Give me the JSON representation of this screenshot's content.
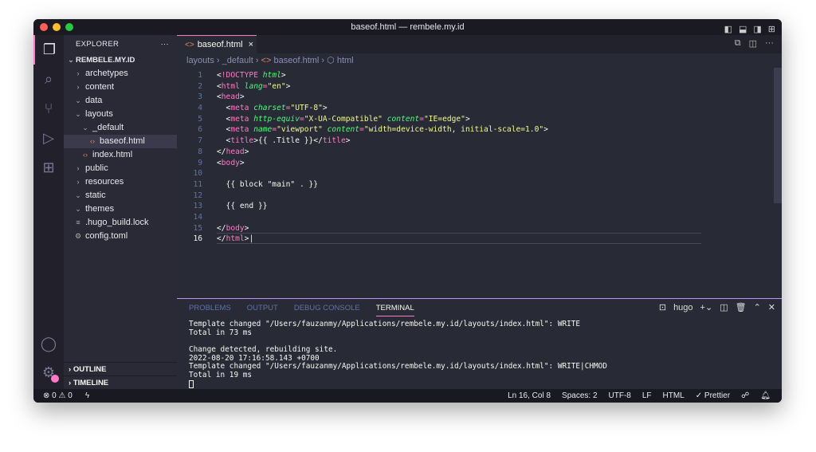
{
  "window": {
    "title": "baseof.html — rembele.my.id",
    "traffic": [
      "#ff5f57",
      "#febc2e",
      "#28c840"
    ]
  },
  "activity": [
    "files-icon",
    "search-icon",
    "source-control-icon",
    "run-debug-icon",
    "extensions-icon"
  ],
  "sidebar": {
    "title": "EXPLORER",
    "more": "···",
    "root": "REMBELE.MY.ID",
    "items": [
      {
        "label": "archetypes",
        "depth": 1,
        "type": "closed"
      },
      {
        "label": "content",
        "depth": 1,
        "type": "closed"
      },
      {
        "label": "data",
        "depth": 1,
        "type": "open"
      },
      {
        "label": "layouts",
        "depth": 1,
        "type": "open"
      },
      {
        "label": "_default",
        "depth": 2,
        "type": "open"
      },
      {
        "label": "baseof.html",
        "depth": 3,
        "type": "html",
        "selected": true
      },
      {
        "label": "index.html",
        "depth": 2,
        "type": "html"
      },
      {
        "label": "public",
        "depth": 1,
        "type": "closed"
      },
      {
        "label": "resources",
        "depth": 1,
        "type": "closed"
      },
      {
        "label": "static",
        "depth": 1,
        "type": "open"
      },
      {
        "label": "themes",
        "depth": 1,
        "type": "open"
      },
      {
        "label": ".hugo_build.lock",
        "depth": 1,
        "type": "file"
      },
      {
        "label": "config.toml",
        "depth": 1,
        "type": "gear"
      }
    ],
    "outline": "OUTLINE",
    "timeline": "TIMELINE"
  },
  "tab": {
    "label": "baseof.html",
    "close": "×"
  },
  "breadcrumbs": [
    "layouts",
    "_default",
    "baseof.html",
    "html"
  ],
  "code": [
    [
      [
        "<",
        "br"
      ],
      [
        "!DOCTYPE",
        "tag"
      ],
      [
        " html",
        "attr"
      ],
      [
        ">",
        "br"
      ]
    ],
    [
      [
        "<",
        "br"
      ],
      [
        "html",
        "tag"
      ],
      [
        " lang",
        "attr"
      ],
      [
        "=",
        "tag"
      ],
      [
        "\"en\"",
        "str"
      ],
      [
        ">",
        "br"
      ]
    ],
    [
      [
        "<",
        "br"
      ],
      [
        "head",
        "tag"
      ],
      [
        ">",
        "br"
      ]
    ],
    [
      [
        "  <",
        "br"
      ],
      [
        "meta",
        "tag"
      ],
      [
        " charset",
        "attr"
      ],
      [
        "=",
        "tag"
      ],
      [
        "\"UTF-8\"",
        "str"
      ],
      [
        ">",
        "br"
      ]
    ],
    [
      [
        "  <",
        "br"
      ],
      [
        "meta",
        "tag"
      ],
      [
        " http-equiv",
        "attr"
      ],
      [
        "=",
        "tag"
      ],
      [
        "\"X-UA-Compatible\"",
        "str"
      ],
      [
        " content",
        "attr"
      ],
      [
        "=",
        "tag"
      ],
      [
        "\"IE=edge\"",
        "str"
      ],
      [
        ">",
        "br"
      ]
    ],
    [
      [
        "  <",
        "br"
      ],
      [
        "meta",
        "tag"
      ],
      [
        " name",
        "attr"
      ],
      [
        "=",
        "tag"
      ],
      [
        "\"viewport\"",
        "str"
      ],
      [
        " content",
        "attr"
      ],
      [
        "=",
        "tag"
      ],
      [
        "\"width=device-width, initial-scale=1.0\"",
        "str"
      ],
      [
        ">",
        "br"
      ]
    ],
    [
      [
        "  <",
        "br"
      ],
      [
        "title",
        "tag"
      ],
      [
        ">{{ .Title }}</",
        "br"
      ],
      [
        "title",
        "tag"
      ],
      [
        ">",
        "br"
      ]
    ],
    [
      [
        "</",
        "br"
      ],
      [
        "head",
        "tag"
      ],
      [
        ">",
        "br"
      ]
    ],
    [
      [
        "<",
        "br"
      ],
      [
        "body",
        "tag"
      ],
      [
        ">",
        "br"
      ]
    ],
    [],
    [
      [
        "  {{ block \"main\" . }}",
        "txt"
      ]
    ],
    [],
    [
      [
        "  {{ end }}",
        "txt"
      ]
    ],
    [],
    [
      [
        "</",
        "br"
      ],
      [
        "body",
        "tag"
      ],
      [
        ">",
        "br"
      ]
    ],
    [
      [
        "</",
        "br"
      ],
      [
        "html",
        "tag"
      ],
      [
        ">",
        "br"
      ]
    ]
  ],
  "panel": {
    "tabs": [
      "PROBLEMS",
      "OUTPUT",
      "DEBUG CONSOLE",
      "TERMINAL"
    ],
    "active": 3,
    "terminal_name": "hugo",
    "lines": [
      "Template changed \"/Users/fauzanmy/Applications/rembele.my.id/layouts/index.html\": WRITE",
      "Total in 73 ms",
      "",
      "Change detected, rebuilding site.",
      "2022-08-20 17:16:58.143 +0700",
      "Template changed \"/Users/fauzanmy/Applications/rembele.my.id/layouts/index.html\": WRITE|CHMOD",
      "Total in 19 ms"
    ]
  },
  "status": {
    "errors": "0",
    "warnings": "0",
    "position": "Ln 16, Col 8",
    "spaces": "Spaces: 2",
    "encoding": "UTF-8",
    "eol": "LF",
    "language": "HTML",
    "prettier": "✓ Prettier"
  }
}
